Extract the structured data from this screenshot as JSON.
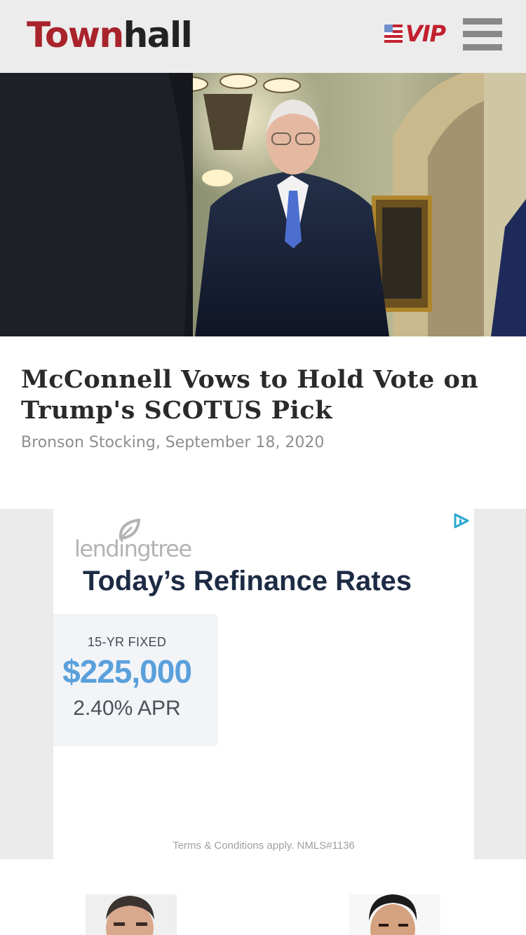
{
  "header": {
    "logo_part1": "Town",
    "logo_part2": "hall",
    "vip_label": "VIP",
    "flag_icon": "us-flag-icon",
    "menu_icon": "hamburger-menu-icon",
    "brand_red": "#a8232b",
    "vip_red": "#c2202e"
  },
  "article": {
    "headline": "McConnell Vows to Hold Vote on Trump's SCOTUS Pick",
    "byline": "Bronson Stocking, September 18, 2020"
  },
  "ad": {
    "brand": "lendingtree",
    "title": "Today’s Refinance Rates",
    "rate_term": "15-YR FIXED",
    "rate_amount": "$225,000",
    "rate_apr": "2.40% APR",
    "terms": "Terms & Conditions apply. NMLS#1136",
    "adchoices_icon": "adchoices-icon",
    "accent_color": "#5aa0dc"
  }
}
